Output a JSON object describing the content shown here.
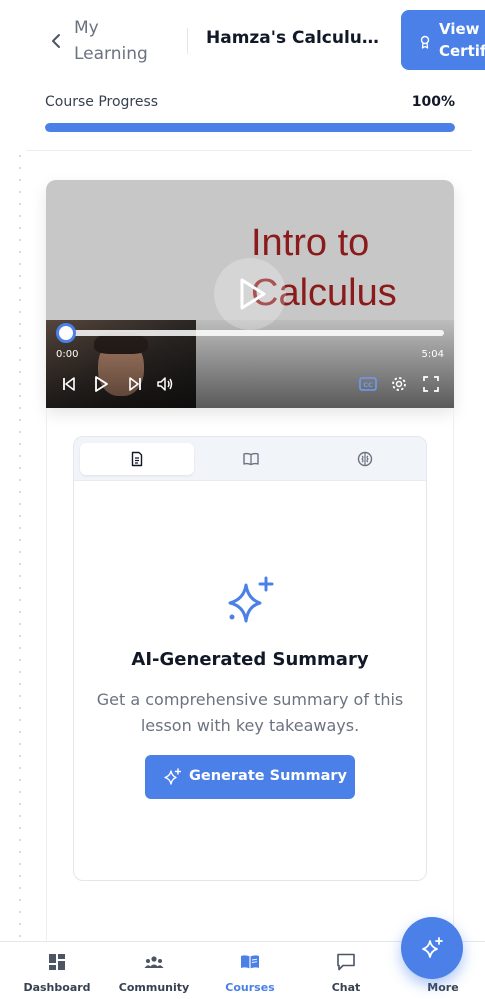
{
  "header": {
    "back_label": "My Learning",
    "course_title": "Hamza's Calculus ...",
    "certificate_label": "View Certif"
  },
  "progress": {
    "label": "Course Progress",
    "percent_text": "100%",
    "value": 1.0
  },
  "video": {
    "slide_text": "Intro to Calculus",
    "current_time": "0:00",
    "duration": "5:04",
    "played_fraction": 0.0
  },
  "tabs": [
    {
      "icon": "document-icon",
      "active": true
    },
    {
      "icon": "book-icon",
      "active": false
    },
    {
      "icon": "brain-icon",
      "active": false
    }
  ],
  "summary": {
    "title": "AI-Generated Summary",
    "description": "Get a comprehensive summary of this lesson with key takeaways.",
    "button_label": "Generate Summary"
  },
  "nav": {
    "items": [
      {
        "label": "Dashboard",
        "icon": "dashboard-icon",
        "active": false
      },
      {
        "label": "Community",
        "icon": "community-icon",
        "active": false
      },
      {
        "label": "Courses",
        "icon": "courses-icon",
        "active": true
      },
      {
        "label": "Chat",
        "icon": "chat-icon",
        "active": false
      },
      {
        "label": "More",
        "icon": "more-icon",
        "active": false
      }
    ]
  },
  "colors": {
    "accent": "#4a80e8",
    "slide_text": "#8b1a1a"
  }
}
